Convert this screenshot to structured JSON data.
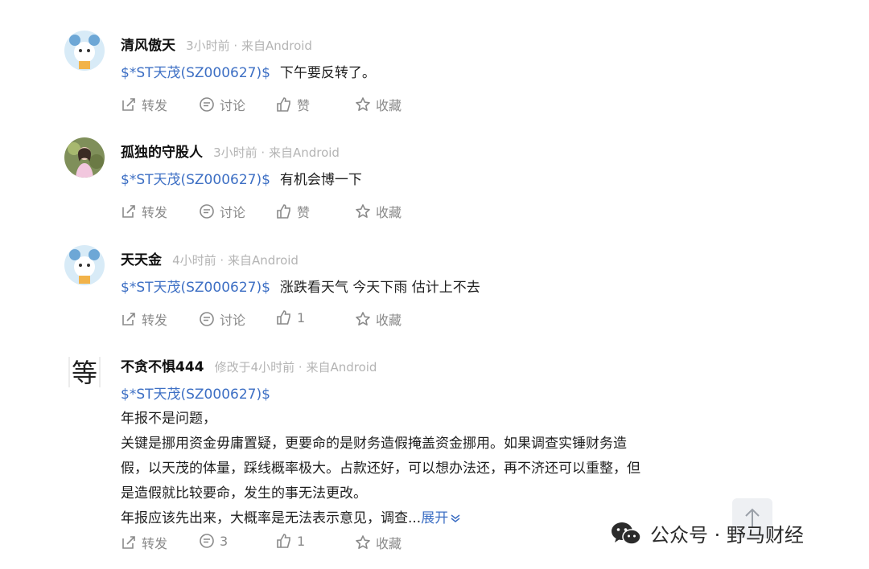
{
  "posts": [
    {
      "username": "清风傲天",
      "meta": "3小时前 · 来自Android",
      "stock": "$*ST天茂(SZ000627)$",
      "text": "下午要反转了。",
      "actions": {
        "repost": "转发",
        "comment": "讨论",
        "like": "赞",
        "favorite": "收藏"
      }
    },
    {
      "username": "孤独的守股人",
      "meta": "3小时前 · 来自Android",
      "stock": "$*ST天茂(SZ000627)$",
      "text": "有机会博一下",
      "actions": {
        "repost": "转发",
        "comment": "讨论",
        "like": "赞",
        "favorite": "收藏"
      }
    },
    {
      "username": "天天金",
      "meta": "4小时前 · 来自Android",
      "stock": "$*ST天茂(SZ000627)$",
      "text": "涨跌看天气 今天下雨 估计上不去",
      "actions": {
        "repost": "转发",
        "comment": "讨论",
        "like": "1",
        "favorite": "收藏"
      }
    },
    {
      "username": "不贪不惧444",
      "meta": "修改于4小时前 · 来自Android",
      "stock": "$*ST天茂(SZ000627)$",
      "lines": [
        "年报不是问题，",
        "关键是挪用资金毋庸置疑，更要命的是财务造假掩盖资金挪用。如果调查实锤财务造",
        "假，以天茂的体量，踩线概率极大。占款还好，可以想办法还，再不济还可以重整，但",
        "是造假就比较要命，发生的事无法更改。",
        "年报应该先出来，大概率是无法表示意见，调查..."
      ],
      "expand": "展开",
      "avatar_char": "等",
      "actions": {
        "repost": "转发",
        "comment": "3",
        "like": "1",
        "favorite": "收藏"
      }
    }
  ],
  "watermark": {
    "label": "公众号 · 野马财经"
  },
  "colors": {
    "link": "#3d6fc4",
    "meta": "#b4b4b4",
    "action": "#8a8a8a"
  }
}
